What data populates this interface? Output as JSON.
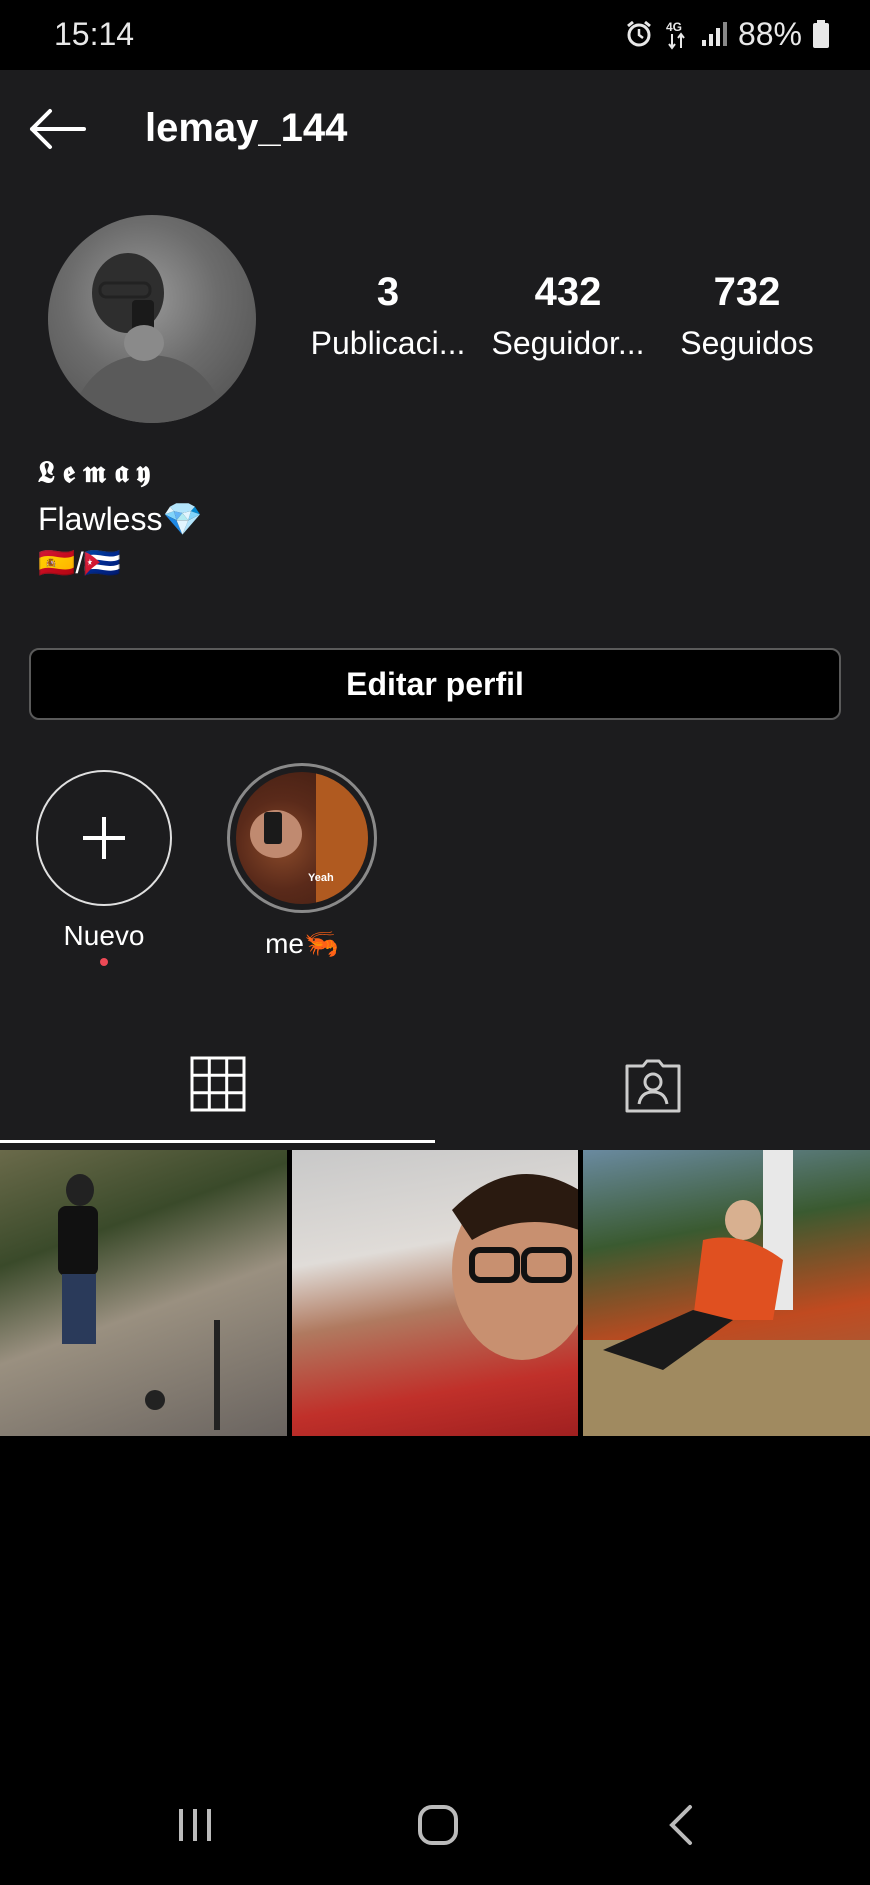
{
  "status_bar": {
    "time": "15:14",
    "network": "4G",
    "battery": "88%"
  },
  "header": {
    "username": "lemay_144"
  },
  "stats": {
    "posts": {
      "count": "3",
      "label": "Publicaci..."
    },
    "followers": {
      "count": "432",
      "label": "Seguidor..."
    },
    "following": {
      "count": "732",
      "label": "Seguidos"
    }
  },
  "bio": {
    "name": "𝕷𝖊𝖒𝖆𝖞",
    "line1": "Flawless💎",
    "line2": "🇪🇸/🇨🇺"
  },
  "edit_profile_label": "Editar perfil",
  "highlights": [
    {
      "label": "Nuevo"
    },
    {
      "label": "me🦐",
      "caption": "Yeah"
    }
  ],
  "tabs": [
    {
      "icon": "grid-icon",
      "active": true
    },
    {
      "icon": "tagged-icon",
      "active": false
    }
  ],
  "posts_count": 3,
  "colors": {
    "background": "#1c1c1e",
    "notification_dot": "#ed4956"
  }
}
